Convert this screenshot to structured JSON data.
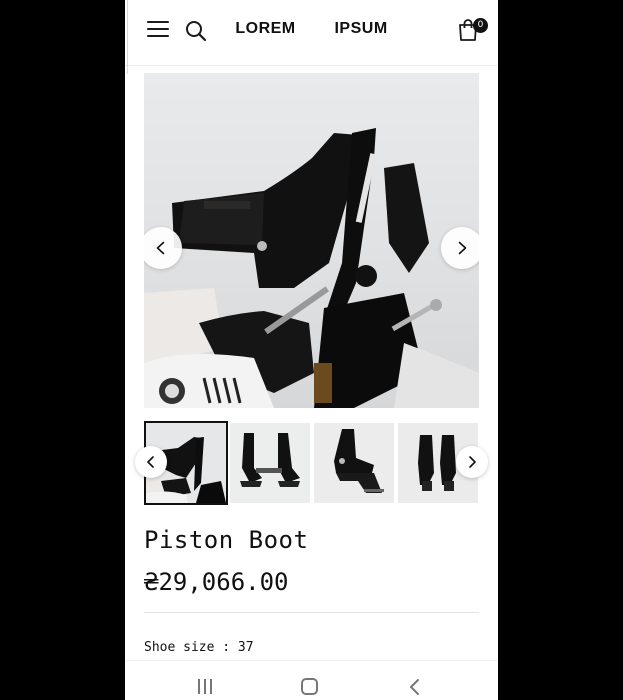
{
  "header": {
    "logo": "LOREM   IPSUM",
    "cart_count": "0"
  },
  "gallery": {
    "main_image_label": "Piston Boot product photo",
    "thumbnails": [
      "Piston Boot view 1",
      "Piston Boot view 2",
      "Piston Boot view 3",
      "Piston Boot view 4"
    ]
  },
  "product": {
    "title": "Piston Boot",
    "price": "₴29,066.00",
    "size_label": "Shoe size : ",
    "size_value": "37"
  },
  "colors": {
    "text": "#111111",
    "background": "#ffffff",
    "frame": "#000000"
  },
  "icons": {
    "menu": "hamburger-icon",
    "search": "search-icon",
    "cart": "shopping-bag-icon",
    "prev": "chevron-left-icon",
    "next": "chevron-right-icon"
  }
}
